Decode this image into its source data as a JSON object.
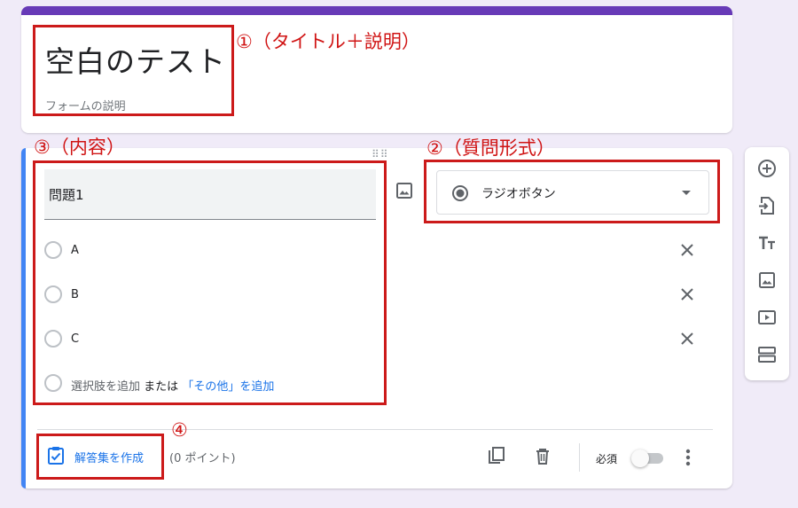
{
  "form": {
    "title": "空白のテスト",
    "description": "フォームの説明"
  },
  "question": {
    "text": "問題1",
    "type_label": "ラジオボタン",
    "options": [
      {
        "label": "A"
      },
      {
        "label": "B"
      },
      {
        "label": "C"
      }
    ],
    "add_option": "選択肢を追加",
    "or_text": "または",
    "add_other": "「その他」を追加"
  },
  "footer": {
    "answer_key": "解答集を作成",
    "points": "(0 ポイント)",
    "required": "必須",
    "required_on": false
  },
  "annotations": {
    "a1": "①（タイトル＋説明）",
    "a2": "②（質問形式）",
    "a3": "③（内容）",
    "a4": "④"
  },
  "colors": {
    "theme": "#673ab7",
    "focus_bar": "#4285f4",
    "link": "#1a73e8",
    "annotation": "#cc1a1a",
    "background": "#f0ebf8"
  },
  "toolbar_icons": [
    "add-question-icon",
    "import-questions-icon",
    "add-title-icon",
    "add-image-icon",
    "add-video-icon",
    "add-section-icon"
  ]
}
